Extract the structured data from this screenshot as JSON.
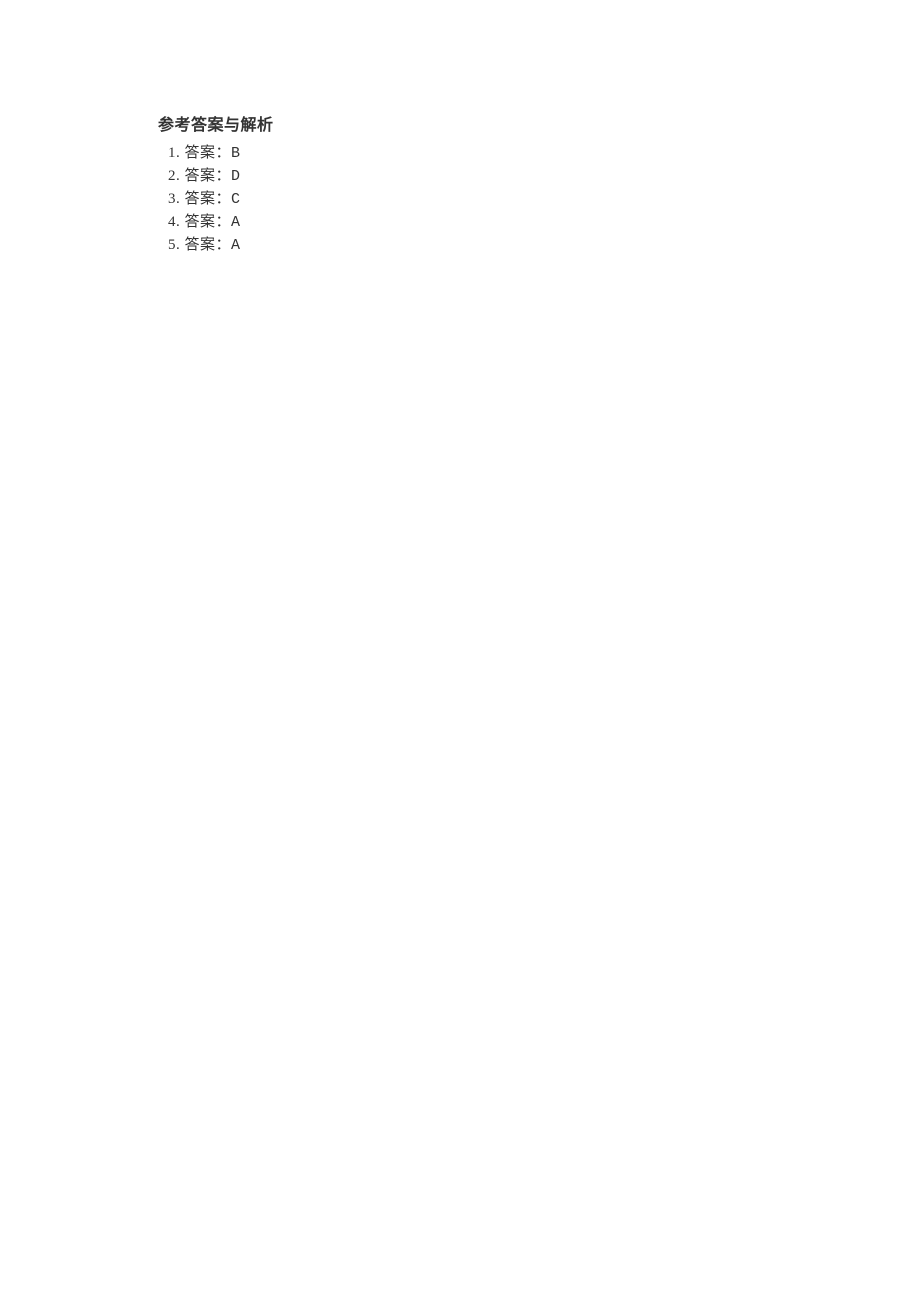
{
  "heading": "参考答案与解析",
  "answers": [
    {
      "number": "1.",
      "label": "答案：",
      "value": "B"
    },
    {
      "number": "2.",
      "label": "答案：",
      "value": "D"
    },
    {
      "number": "3.",
      "label": "答案：",
      "value": "C"
    },
    {
      "number": "4.",
      "label": "答案：",
      "value": "A"
    },
    {
      "number": "5.",
      "label": "答案：",
      "value": "A"
    }
  ]
}
